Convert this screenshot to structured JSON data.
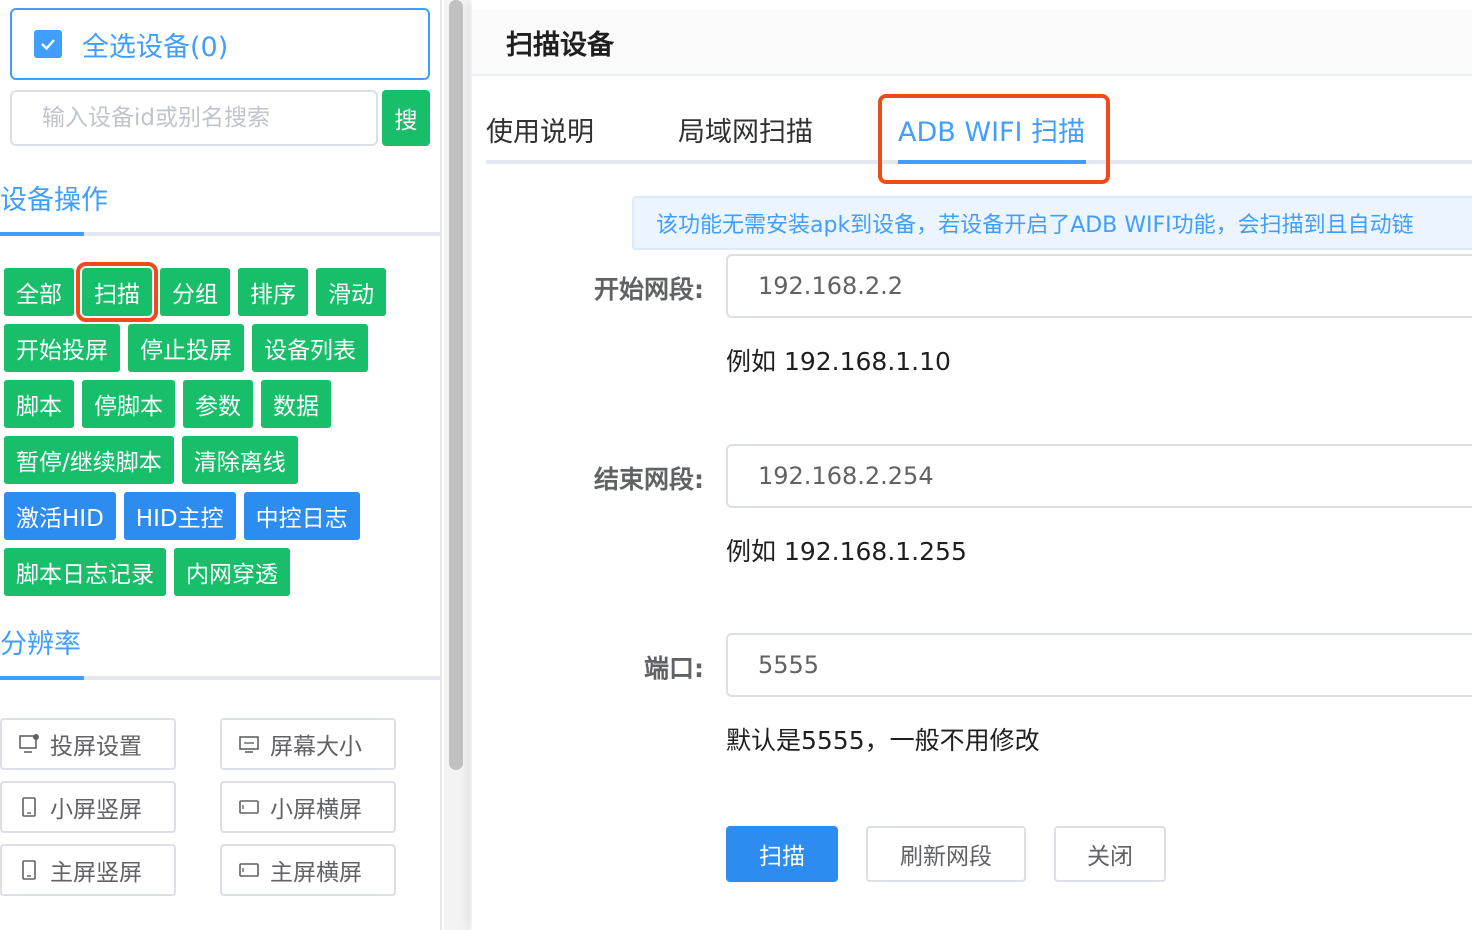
{
  "sidebar": {
    "select_all_label": "全选设备(0)",
    "search_placeholder": "输入设备id或别名搜索",
    "search_button": "搜",
    "device_ops_title": "设备操作",
    "ops_rows": [
      [
        {
          "label": "全部",
          "color": "green"
        },
        {
          "label": "扫描",
          "color": "green",
          "highlight": true
        },
        {
          "label": "分组",
          "color": "green"
        },
        {
          "label": "排序",
          "color": "green"
        },
        {
          "label": "滑动",
          "color": "green"
        }
      ],
      [
        {
          "label": "开始投屏",
          "color": "green"
        },
        {
          "label": "停止投屏",
          "color": "green"
        },
        {
          "label": "设备列表",
          "color": "green"
        }
      ],
      [
        {
          "label": "脚本",
          "color": "green"
        },
        {
          "label": "停脚本",
          "color": "green"
        },
        {
          "label": "参数",
          "color": "green"
        },
        {
          "label": "数据",
          "color": "green"
        }
      ],
      [
        {
          "label": "暂停/继续脚本",
          "color": "green"
        },
        {
          "label": "清除离线",
          "color": "green"
        }
      ],
      [
        {
          "label": "激活HID",
          "color": "blue"
        },
        {
          "label": "HID主控",
          "color": "blue"
        },
        {
          "label": "中控日志",
          "color": "blue"
        }
      ],
      [
        {
          "label": "脚本日志记录",
          "color": "green"
        },
        {
          "label": "内网穿透",
          "color": "green"
        }
      ]
    ],
    "resolution_title": "分辨率",
    "resolution_buttons": [
      {
        "label": "投屏设置",
        "icon": "monitor-settings-icon"
      },
      {
        "label": "屏幕大小",
        "icon": "screen-size-icon"
      },
      {
        "label": "小屏竖屏",
        "icon": "portrait-icon"
      },
      {
        "label": "小屏横屏",
        "icon": "landscape-icon"
      },
      {
        "label": "主屏竖屏",
        "icon": "portrait-icon"
      },
      {
        "label": "主屏横屏",
        "icon": "landscape-icon"
      }
    ]
  },
  "dialog": {
    "title": "扫描设备",
    "tabs": [
      "使用说明",
      "局域网扫描",
      "ADB WIFI 扫描"
    ],
    "active_tab": 2,
    "alert": "该功能无需安装apk到设备，若设备开启了ADB WIFI功能，会扫描到且自动链",
    "start_label": "开始网段:",
    "start_value": "192.168.2.2",
    "start_hint": "例如 192.168.1.10",
    "end_label": "结束网段:",
    "end_value": "192.168.2.254",
    "end_hint": "例如 192.168.1.255",
    "port_label": "端口:",
    "port_value": "5555",
    "port_hint": "默认是5555，一般不用修改",
    "buttons": {
      "scan": "扫描",
      "refresh": "刷新网段",
      "close": "关闭"
    }
  },
  "colors": {
    "primary": "#409eff",
    "green": "#19be6b",
    "blue": "#2d8cf0",
    "highlight": "#ee4a1b"
  }
}
